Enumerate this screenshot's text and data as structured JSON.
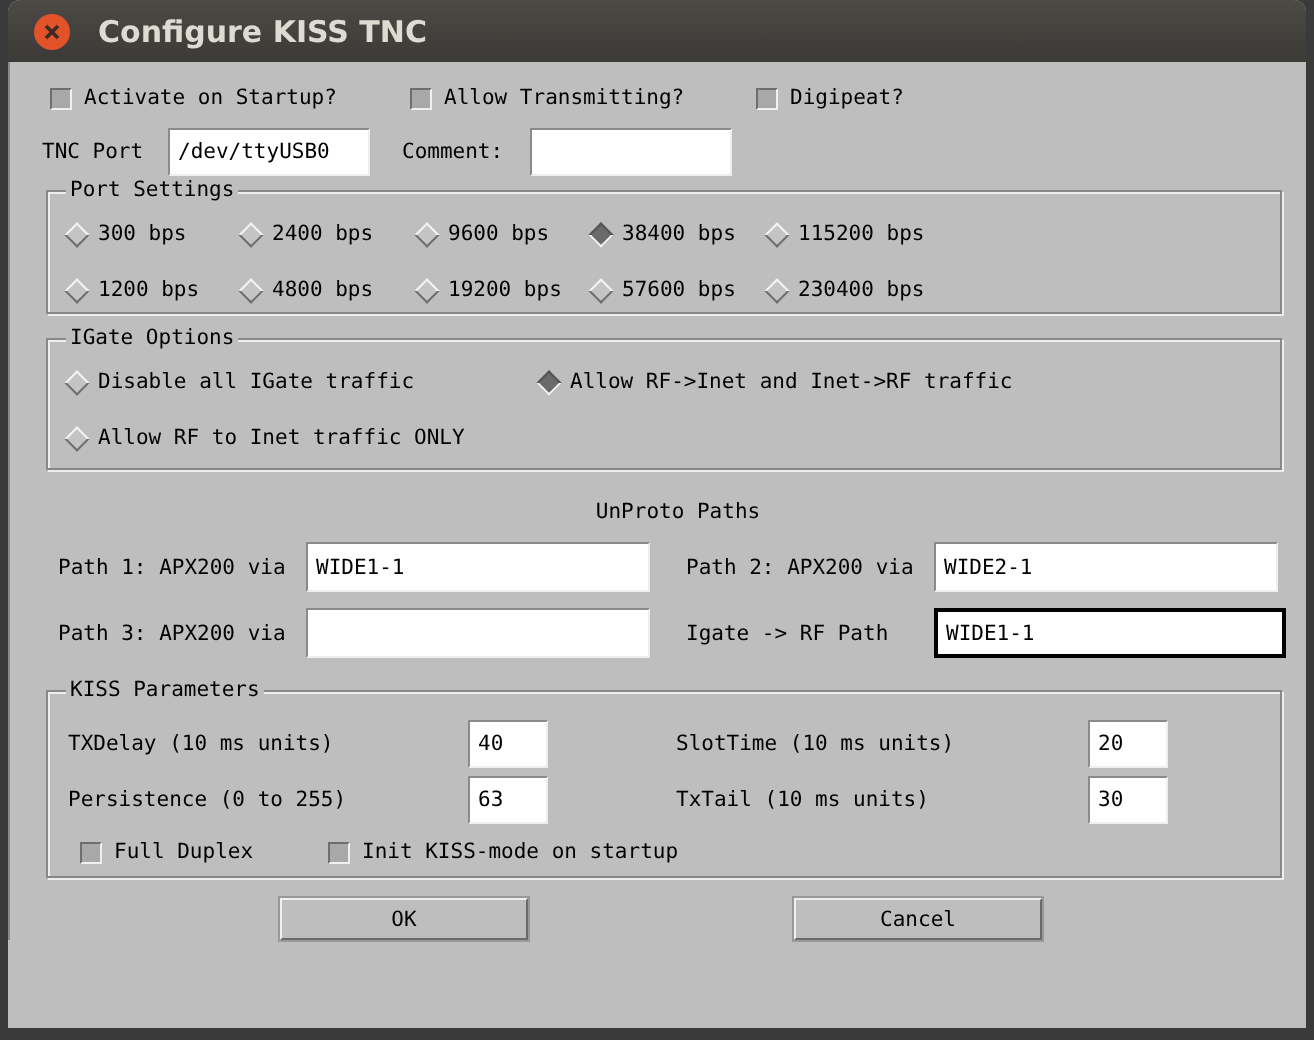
{
  "window": {
    "title": "Configure KISS TNC"
  },
  "options": [
    {
      "label": "Activate on Startup?",
      "checked": false
    },
    {
      "label": "Allow Transmitting?",
      "checked": false
    },
    {
      "label": "Digipeat?",
      "checked": false
    }
  ],
  "tnc_port": {
    "label": "TNC Port",
    "value": "/dev/ttyUSB0"
  },
  "comment": {
    "label": "Comment:"
  },
  "port_settings": {
    "title": "Port Settings",
    "rates": [
      {
        "label": "300 bps",
        "selected": false
      },
      {
        "label": "2400 bps",
        "selected": false
      },
      {
        "label": "9600 bps",
        "selected": false
      },
      {
        "label": "38400 bps",
        "selected": true
      },
      {
        "label": "115200 bps",
        "selected": false
      },
      {
        "label": "1200 bps",
        "selected": false
      },
      {
        "label": "4800 bps",
        "selected": false
      },
      {
        "label": "19200 bps",
        "selected": false
      },
      {
        "label": "57600 bps",
        "selected": false
      },
      {
        "label": "230400 bps",
        "selected": false
      }
    ]
  },
  "igate_options": {
    "title": "IGate Options",
    "choices": [
      {
        "label": "Disable all IGate traffic",
        "selected": false
      },
      {
        "label": "Allow RF->Inet and Inet->RF traffic",
        "selected": true
      },
      {
        "label": "Allow RF to Inet traffic ONLY",
        "selected": false
      }
    ]
  },
  "unproto": {
    "title": "UnProto Paths",
    "paths": [
      {
        "label": "Path 1: APX200 via",
        "value": "WIDE1-1",
        "focused": false
      },
      {
        "label": "Path 2: APX200 via",
        "value": "WIDE2-1",
        "focused": false
      },
      {
        "label": "Path 3: APX200 via",
        "focused": false
      },
      {
        "label": "Igate -> RF Path",
        "value": "WIDE1-1",
        "focused": true
      }
    ]
  },
  "kiss": {
    "title": "KISS Parameters",
    "params": [
      {
        "label": "TXDelay (10 ms units)",
        "value": "40"
      },
      {
        "label": "SlotTime (10 ms units)",
        "value": "20"
      },
      {
        "label": "Persistence (0 to 255)",
        "value": "63"
      },
      {
        "label": "TxTail (10 ms units)",
        "value": "30"
      }
    ],
    "options": [
      {
        "label": "Full Duplex",
        "checked": false
      },
      {
        "label": "Init KISS-mode on startup",
        "checked": false
      }
    ]
  },
  "buttons": [
    "OK",
    "Cancel"
  ]
}
